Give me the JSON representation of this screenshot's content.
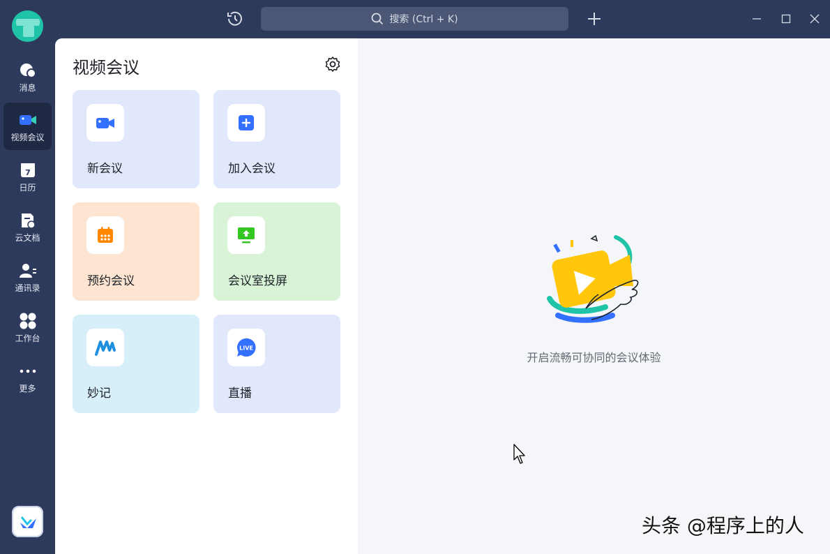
{
  "topbar": {
    "search_placeholder": "搜索 (Ctrl + K)"
  },
  "sidebar": {
    "items": [
      {
        "label": "消息",
        "icon": "message-icon"
      },
      {
        "label": "视频会议",
        "icon": "video-camera-icon",
        "active": true
      },
      {
        "label": "日历",
        "icon": "calendar-icon"
      },
      {
        "label": "云文档",
        "icon": "cloud-doc-icon"
      },
      {
        "label": "通讯录",
        "icon": "contacts-icon"
      },
      {
        "label": "工作台",
        "icon": "workbench-icon"
      },
      {
        "label": "更多",
        "icon": "more-icon"
      }
    ]
  },
  "panel": {
    "title": "视频会议",
    "cards": [
      {
        "label": "新会议",
        "icon": "video-camera-icon",
        "color": "#e1e8fb"
      },
      {
        "label": "加入会议",
        "icon": "plus-square-icon",
        "color": "#e1e8fb"
      },
      {
        "label": "预约会议",
        "icon": "calendar-schedule-icon",
        "color": "#fde5d2"
      },
      {
        "label": "会议室投屏",
        "icon": "screen-cast-icon",
        "color": "#d8f3d6"
      },
      {
        "label": "妙记",
        "icon": "minutes-icon",
        "color": "#d6eff9"
      },
      {
        "label": "直播",
        "icon": "live-icon",
        "color": "#e1e8fb"
      }
    ]
  },
  "main": {
    "slogan": "开启流畅可协同的会议体验"
  },
  "watermark": "头条 @程序上的人",
  "colors": {
    "rail_bg": "#2e3a5c",
    "accent_blue": "#3370ff",
    "orange": "#ff8800",
    "green": "#34c724"
  }
}
